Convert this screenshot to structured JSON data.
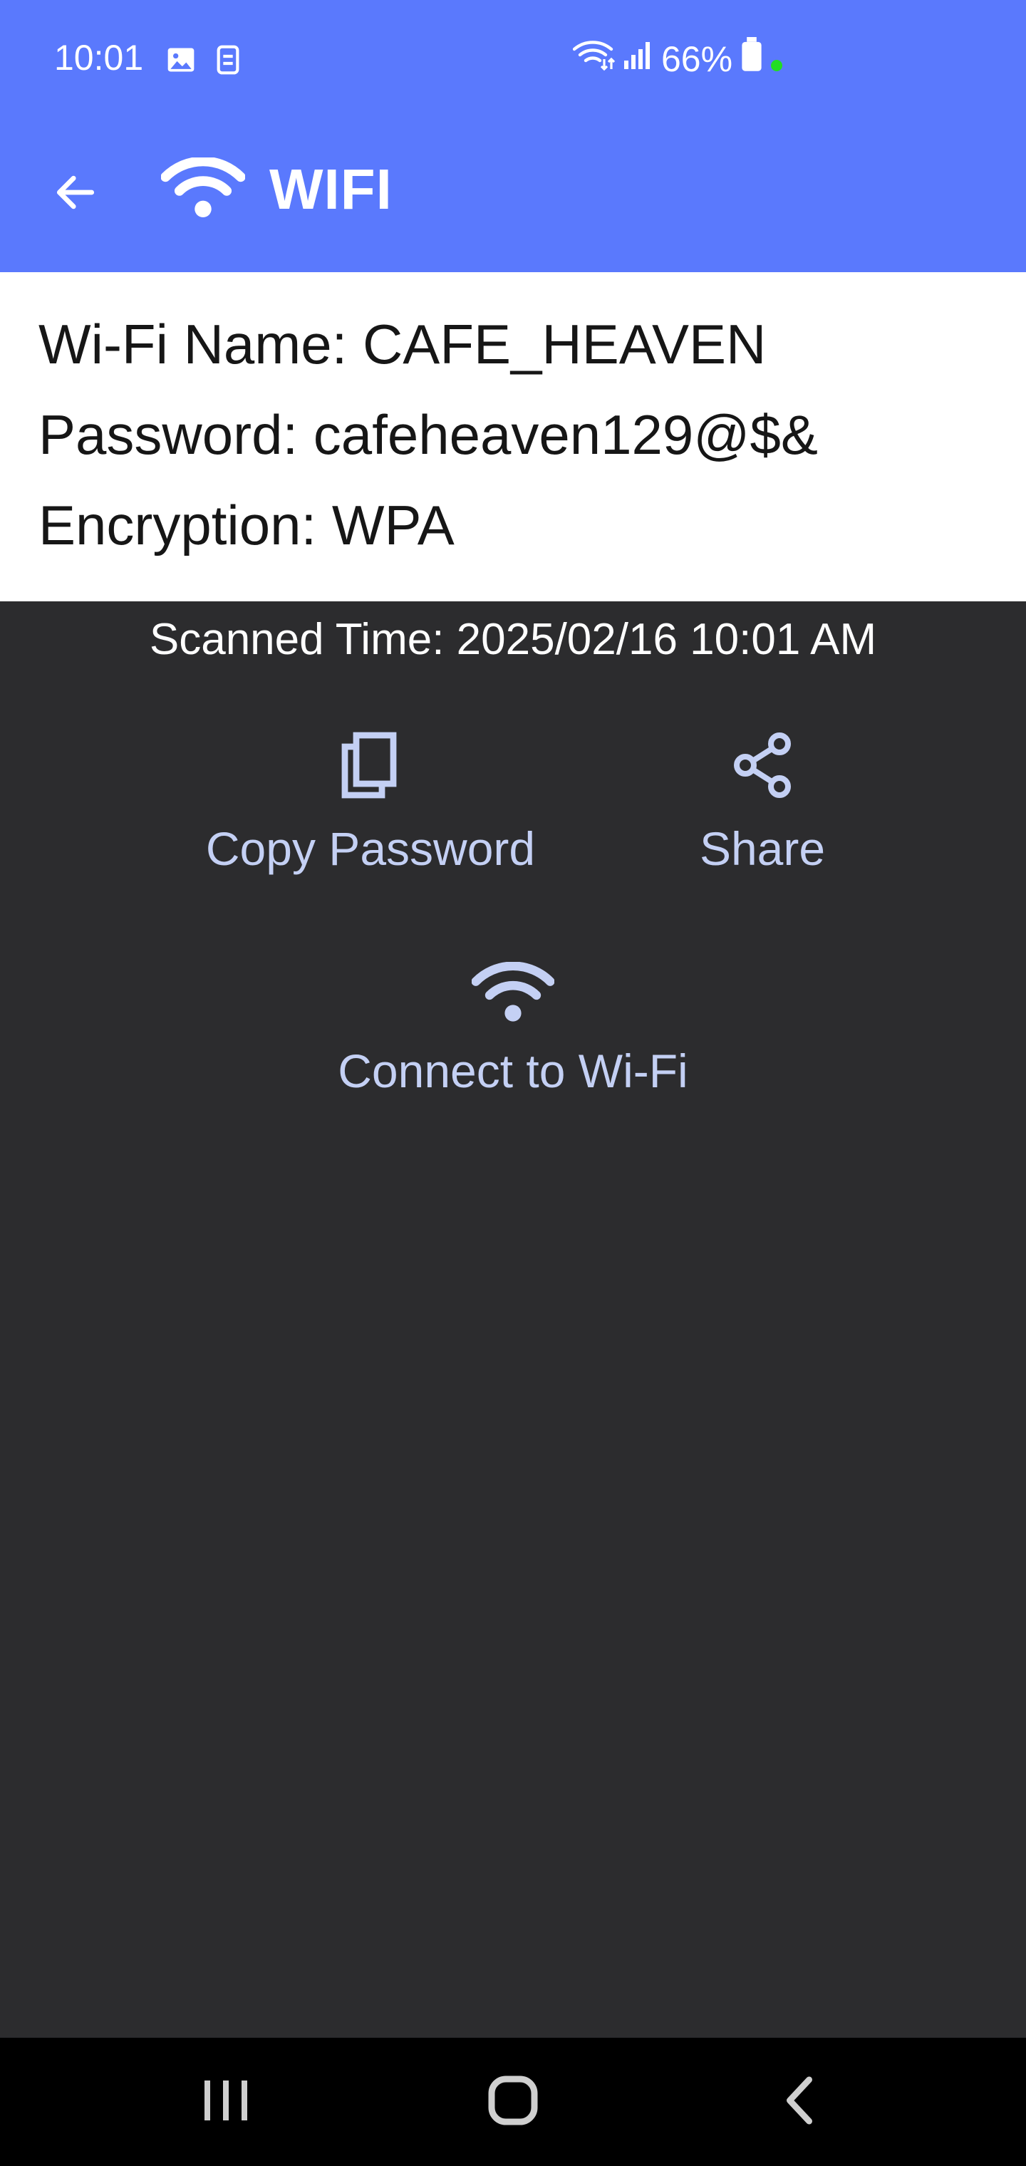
{
  "status_bar": {
    "time": "10:01",
    "battery": "66%",
    "icons_left": [
      "image-icon",
      "sync-icon"
    ],
    "icons_right": [
      "wifi-data-icon",
      "signal-icon",
      "battery-icon"
    ]
  },
  "app_bar": {
    "title": "WIFI",
    "back_icon": "arrow-left-icon",
    "title_icon": "wifi-icon",
    "color": "#5a79fd"
  },
  "wifi_info": {
    "name_line": "Wi-Fi Name: CAFE_HEAVEN",
    "password_line": "Password: cafeheaven129@$&",
    "encryption_line": "Encryption: WPA"
  },
  "scanned_time": "Scanned Time: 2025/02/16 10:01 AM",
  "actions": {
    "copy_password": {
      "label": "Copy Password",
      "icon": "copy-icon"
    },
    "share": {
      "label": "Share",
      "icon": "share-icon"
    },
    "connect": {
      "label": "Connect to Wi-Fi",
      "icon": "wifi-icon"
    }
  },
  "nav_bar": {
    "buttons": [
      "recents-icon",
      "home-icon",
      "back-icon"
    ]
  },
  "colors": {
    "background": "#2c2c2e",
    "action_tint": "#c4d0f4",
    "accent": "#5a79fd"
  }
}
